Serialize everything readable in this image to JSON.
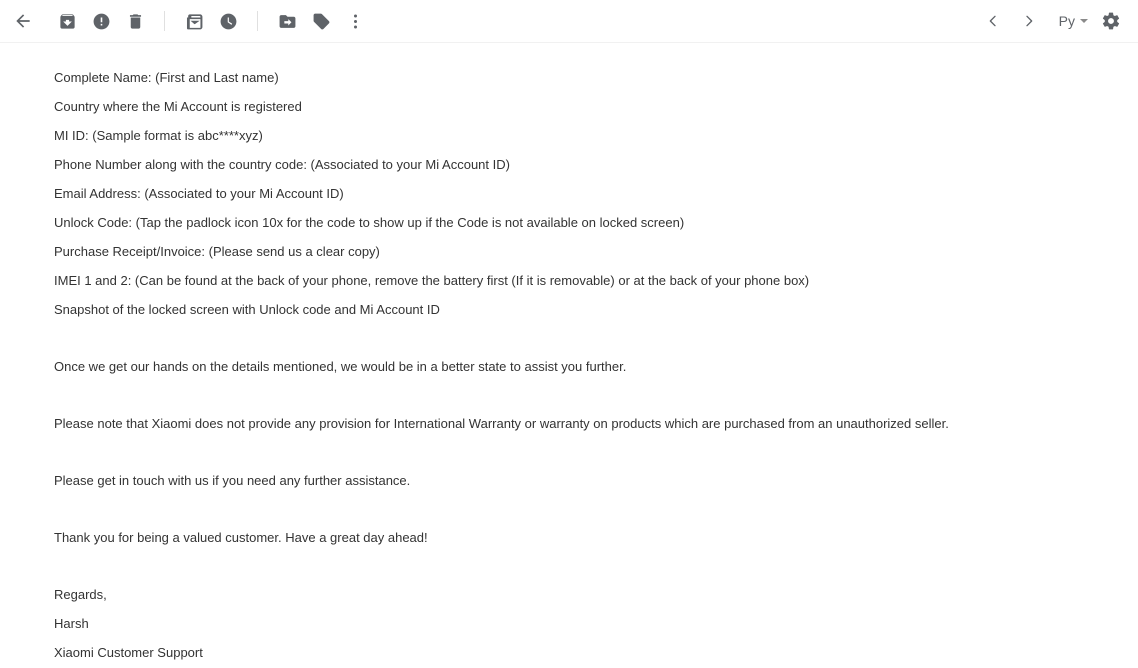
{
  "toolbar": {
    "left_actions": [
      {
        "name": "back-icon",
        "label": "Back to inbox"
      },
      {
        "name": "archive-icon",
        "label": "Archive"
      },
      {
        "name": "report-spam-icon",
        "label": "Report spam"
      },
      {
        "name": "delete-icon",
        "label": "Delete"
      },
      {
        "name": "mark-unread-icon",
        "label": "Mark as unread"
      },
      {
        "name": "snooze-clock-icon",
        "label": "Snooze"
      },
      {
        "name": "move-to-folder-icon",
        "label": "Move to"
      },
      {
        "name": "label-tag-icon",
        "label": "Labels"
      },
      {
        "name": "more-options-icon",
        "label": "More"
      }
    ],
    "prev_label": "Older",
    "next_label": "Newer",
    "account_label": "Py",
    "settings_label": "Settings"
  },
  "message": {
    "details": [
      "Complete Name: (First and Last name)",
      "Country where the Mi Account is registered",
      "MI ID: (Sample format is abc****xyz)",
      "Phone Number along with the country code: (Associated to your Mi Account ID)",
      "Email Address: (Associated to your Mi Account ID)",
      "Unlock Code: (Tap the padlock icon 10x for the code to show up if the Code is not available on locked screen)",
      "Purchase Receipt/Invoice: (Please send us a clear copy)",
      "IMEI 1 and 2: (Can be found at the back of your phone, remove the battery first (If it is removable) or at the back of your phone box)",
      "Snapshot of the locked screen with Unlock code and Mi Account ID"
    ],
    "paragraphs": [
      "Once we get our hands on the details mentioned, we would be in a better state to assist you further.",
      "Please note that Xiaomi does not provide any provision for International Warranty or warranty on products which are purchased from an unauthorized seller.",
      "Please get in touch with us if you need any further assistance.",
      "Thank you for being a valued customer. Have a great day ahead!"
    ],
    "signature": [
      "Regards,",
      "Harsh",
      "Xiaomi Customer Support"
    ]
  },
  "colors": {
    "icon": "#5f6368",
    "text": "#333333",
    "divider": "#e0e0e0",
    "border": "#f1f1f1"
  }
}
